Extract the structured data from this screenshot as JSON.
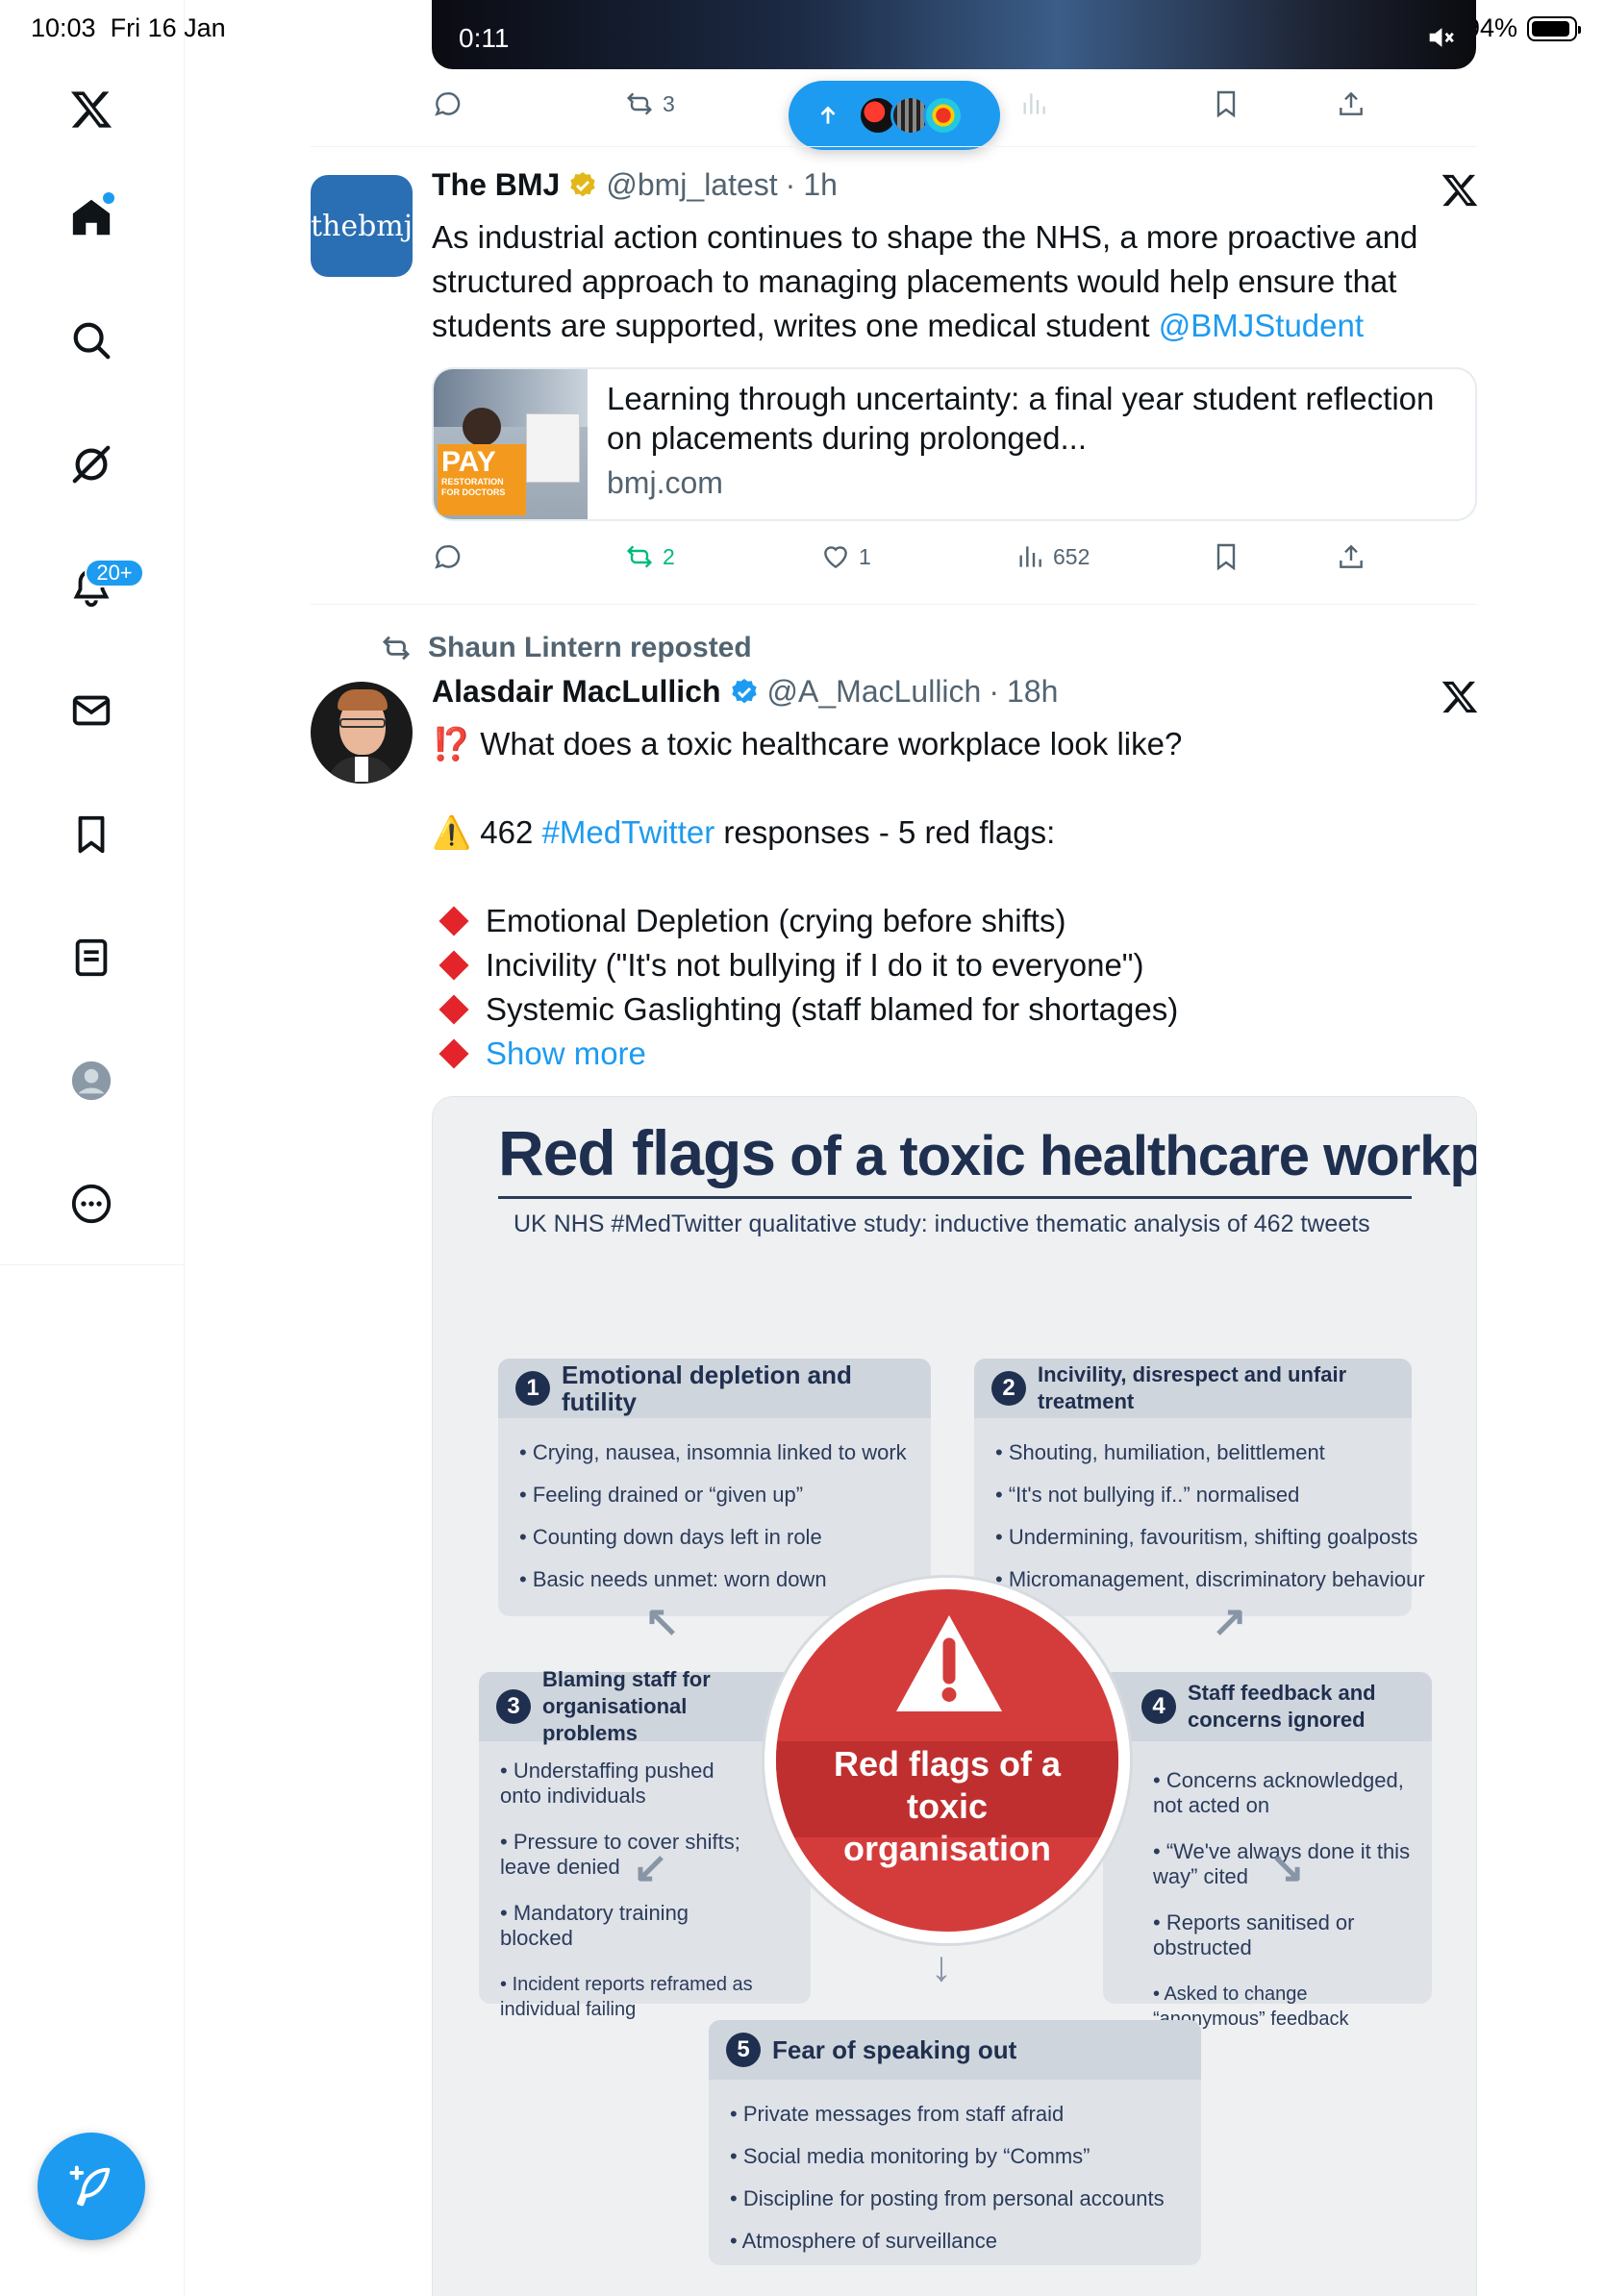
{
  "status_bar": {
    "time": "10:03",
    "date": "Fri 16 Jan",
    "battery": "94%"
  },
  "sidebar": {
    "notifications_badge": "20+",
    "icons": [
      "x-logo-icon",
      "home-icon",
      "search-icon",
      "grok-icon",
      "notifications-icon",
      "messages-icon",
      "bookmarks-icon",
      "lists-icon",
      "profile-icon",
      "more-icon",
      "compose-icon"
    ]
  },
  "video_tweet": {
    "timestamp": "0:11",
    "retweets": "3"
  },
  "tweet1": {
    "name": "The BMJ",
    "handle": "@bmj_latest",
    "time": "1h",
    "avatar_text": "thebmj",
    "text_before": "As industrial action continues to shape the NHS, a more proactive and structured approach to managing placements would help ensure that students are supported, writes one medical student ",
    "mention": "@BMJStudent",
    "card": {
      "title": "Learning through uncertainty: a final year student reflection on placements during prolonged...",
      "domain": "bmj.com",
      "image_text": "PAY",
      "image_subtext": "RESTORATION FOR DOCTORS"
    },
    "retweets": "2",
    "likes": "1",
    "views": "652"
  },
  "tweet2": {
    "reposted_by": "Shaun Lintern reposted",
    "name": "Alasdair MacLullich",
    "handle": "@A_MacLullich",
    "time": "18h",
    "question_emoji": "⁉️",
    "line1": "What does a toxic healthcare workplace look like?",
    "warning_emoji": "⚠️",
    "line2_pre": "462 ",
    "hashtag": "#MedTwitter",
    "line2_post": " responses - 5 red flags:",
    "flags": [
      "Emotional Depletion (crying before shifts)",
      "Incivility (\"It's not bullying if I do it to everyone\")",
      "Systemic Gaslighting (staff blamed for shortages)"
    ],
    "show_more": "Show more"
  },
  "infographic": {
    "title_big": "Red flags",
    "title_rest": " of a toxic healthcare workplace culture",
    "subtitle": "UK NHS #MedTwitter qualitative study: inductive thematic analysis of 462 tweets",
    "center": "Red flags of a toxic organisation",
    "boxes": [
      {
        "num": "1",
        "title": "Emotional depletion and futility",
        "items": [
          "Crying, nausea, insomnia linked to work",
          "Feeling drained or “given up”",
          "Counting down days left in role",
          "Basic needs unmet: worn down"
        ]
      },
      {
        "num": "2",
        "title": "Incivility, disrespect and unfair treatment",
        "items": [
          "Shouting, humiliation, belittlement",
          "“It's not bullying if..” normalised",
          "Undermining, favouritism, shifting goalposts",
          "Micromanagement, discriminatory behaviour"
        ]
      },
      {
        "num": "3",
        "title": "Blaming staff for organisational problems",
        "items": [
          "Understaffing pushed onto individuals",
          "Pressure to cover shifts; leave denied",
          "Mandatory training blocked",
          "Incident reports reframed as individual failing"
        ]
      },
      {
        "num": "4",
        "title": "Staff feedback and concerns ignored",
        "items": [
          "Concerns acknowledged, not acted on",
          "“We've always done it this way” cited",
          "Reports sanitised or obstructed",
          "Asked to change “anonymous” feedback"
        ]
      },
      {
        "num": "5",
        "title": "Fear of speaking out",
        "items": [
          "Private messages from staff afraid",
          "Social media monitoring by “Comms”",
          "Discipline for posting from personal accounts",
          "Atmosphere of surveillance"
        ]
      }
    ]
  }
}
